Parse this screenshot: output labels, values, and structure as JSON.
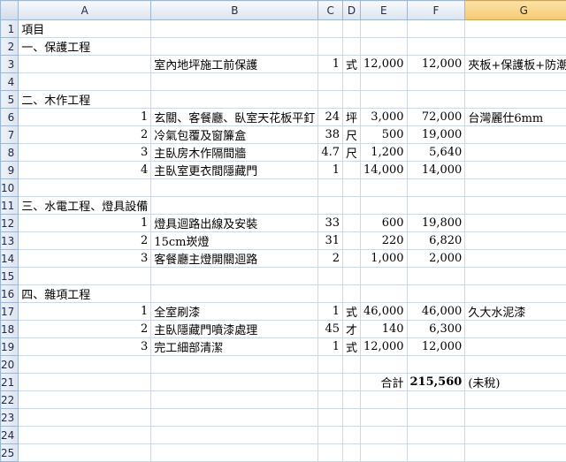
{
  "columns": [
    "A",
    "B",
    "C",
    "D",
    "E",
    "F",
    "G"
  ],
  "rows": [
    {
      "num": "1",
      "a": "項目",
      "b": "",
      "c": "",
      "d": "",
      "e": "",
      "f": "",
      "g": ""
    },
    {
      "num": "2",
      "a": "一、保護工程",
      "b": "",
      "c": "",
      "d": "",
      "e": "",
      "f": "",
      "g": ""
    },
    {
      "num": "3",
      "a": "",
      "b": "室內地坪施工前保護",
      "c": "1",
      "d": "式",
      "e": "12,000",
      "f": "12,000",
      "g": "夾板+保護板+防潮布"
    },
    {
      "num": "4",
      "a": "",
      "b": "",
      "c": "",
      "d": "",
      "e": "",
      "f": "",
      "g": ""
    },
    {
      "num": "5",
      "a": "二、木作工程",
      "b": "",
      "c": "",
      "d": "",
      "e": "",
      "f": "",
      "g": ""
    },
    {
      "num": "6",
      "a": "1",
      "b": "玄關、客餐廳、臥室天花板平釘",
      "c": "24",
      "d": "坪",
      "e": "3,000",
      "f": "72,000",
      "g": "台灣麗仕6mm"
    },
    {
      "num": "7",
      "a": "2",
      "b": "冷氣包覆及窗簾盒",
      "c": "38",
      "d": "尺",
      "e": "500",
      "f": "19,000",
      "g": ""
    },
    {
      "num": "8",
      "a": "3",
      "b": "主臥房木作隔間牆",
      "c": "4.7",
      "d": "尺",
      "e": "1,200",
      "f": "5,640",
      "g": ""
    },
    {
      "num": "9",
      "a": "4",
      "b": "主臥室更衣間隱藏門",
      "c": "1",
      "d": "",
      "e": "14,000",
      "f": "14,000",
      "g": ""
    },
    {
      "num": "10",
      "a": "",
      "b": "",
      "c": "",
      "d": "",
      "e": "",
      "f": "",
      "g": ""
    },
    {
      "num": "11",
      "a": "三、水電工程、燈具設備",
      "b": "",
      "c": "",
      "d": "",
      "e": "",
      "f": "",
      "g": ""
    },
    {
      "num": "12",
      "a": "1",
      "b": "燈具迴路出線及安裝",
      "c": "33",
      "d": "",
      "e": "600",
      "f": "19,800",
      "g": ""
    },
    {
      "num": "13",
      "a": "2",
      "b": "15cm崁燈",
      "c": "31",
      "d": "",
      "e": "220",
      "f": "6,820",
      "g": ""
    },
    {
      "num": "14",
      "a": "3",
      "b": "客餐廳主燈開關迴路",
      "c": "2",
      "d": "",
      "e": "1,000",
      "f": "2,000",
      "g": ""
    },
    {
      "num": "15",
      "a": "",
      "b": "",
      "c": "",
      "d": "",
      "e": "",
      "f": "",
      "g": ""
    },
    {
      "num": "16",
      "a": "四、雜項工程",
      "b": "",
      "c": "",
      "d": "",
      "e": "",
      "f": "",
      "g": ""
    },
    {
      "num": "17",
      "a": "1",
      "b": "全室刷漆",
      "c": "1",
      "d": "式",
      "e": "46,000",
      "f": "46,000",
      "g": "久大水泥漆"
    },
    {
      "num": "18",
      "a": "2",
      "b": "主臥隱藏門噴漆處理",
      "c": "45",
      "d": "才",
      "e": "140",
      "f": "6,300",
      "g": ""
    },
    {
      "num": "19",
      "a": "3",
      "b": "完工細部清潔",
      "c": "1",
      "d": "式",
      "e": "12,000",
      "f": "12,000",
      "g": ""
    },
    {
      "num": "20",
      "a": "",
      "b": "",
      "c": "",
      "d": "",
      "e": "",
      "f": "",
      "g": ""
    },
    {
      "num": "21",
      "a": "",
      "b": "",
      "c": "",
      "d": "",
      "e": "合計",
      "f": "215,560",
      "g": "(未稅)"
    },
    {
      "num": "22",
      "a": "",
      "b": "",
      "c": "",
      "d": "",
      "e": "",
      "f": "",
      "g": ""
    },
    {
      "num": "23",
      "a": "",
      "b": "",
      "c": "",
      "d": "",
      "e": "",
      "f": "",
      "g": ""
    },
    {
      "num": "24",
      "a": "",
      "b": "",
      "c": "",
      "d": "",
      "e": "",
      "f": "",
      "g": ""
    },
    {
      "num": "25",
      "a": "",
      "b": "",
      "c": "",
      "d": "",
      "e": "",
      "f": "",
      "g": ""
    }
  ],
  "selected_column": "G",
  "colors": {
    "header_bg": "#dde4ef",
    "selected_header": "#f6c971",
    "grid": "#d0d7e5"
  }
}
